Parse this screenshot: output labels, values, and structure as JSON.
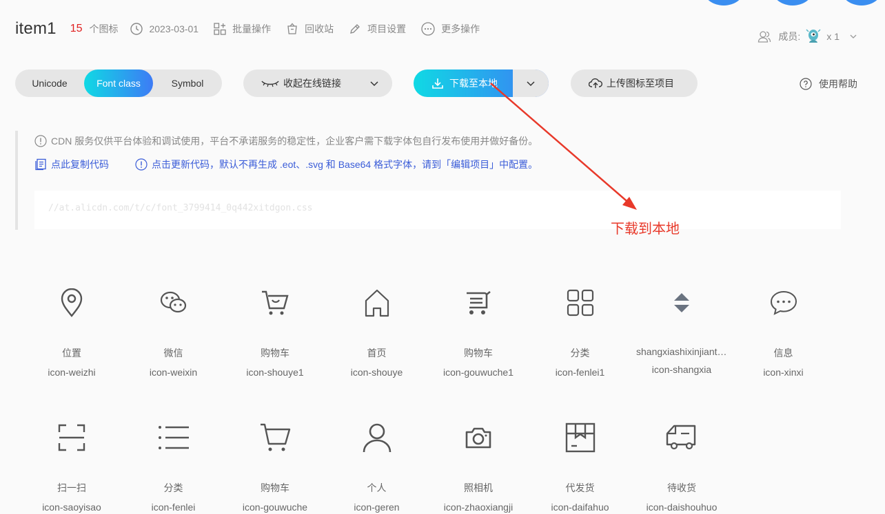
{
  "header": {
    "title": "item1",
    "icon_count": "15",
    "icon_count_label": "个图标",
    "date": "2023-03-01",
    "batch": "批量操作",
    "recycle": "回收站",
    "settings": "项目设置",
    "more": "更多操作",
    "members_label": "成员:",
    "members_count": "x 1"
  },
  "toolbar": {
    "tabs": [
      "Unicode",
      "Font class",
      "Symbol"
    ],
    "active_tab": "Font class",
    "collapse_link": "收起在线链接",
    "download": "下载至本地",
    "upload": "上传图标至项目",
    "help": "使用帮助"
  },
  "notice": {
    "cdn_warning": "CDN 服务仅供平台体验和调试使用，平台不承诺服务的稳定性，企业客户需下载字体包自行发布使用并做好备份。",
    "copy_code": "点此复制代码",
    "update_code": "点击更新代码，默认不再生成 .eot、.svg 和 Base64 格式字体，请到「编辑项目」中配置。",
    "css_url": "//at.alicdn.com/t/c/font_3799414_0q442xitdgon.css"
  },
  "annotation": "下载到本地",
  "colors": {
    "accent_start": "#10d9e4",
    "accent_end": "#3d7bf5",
    "count_red": "#e02020",
    "link_blue": "#3a5cd8",
    "annotation_red": "#e8392a"
  },
  "icons": [
    {
      "name": "位置",
      "code": "icon-weizhi",
      "glyph": "location-icon"
    },
    {
      "name": "微信",
      "code": "icon-weixin",
      "glyph": "wechat-icon"
    },
    {
      "name": "购物车",
      "code": "icon-shouye1",
      "glyph": "cart-smile-icon"
    },
    {
      "name": "首页",
      "code": "icon-shouye",
      "glyph": "home-icon"
    },
    {
      "name": "购物车",
      "code": "icon-gouwuche1",
      "glyph": "cart-list-icon"
    },
    {
      "name": "分类",
      "code": "icon-fenlei1",
      "glyph": "grid-icon"
    },
    {
      "name": "shangxiashixinjiantou",
      "code": "icon-shangxia",
      "glyph": "updown-icon"
    },
    {
      "name": "信息",
      "code": "icon-xinxi",
      "glyph": "message-icon"
    },
    {
      "name": "扫一扫",
      "code": "icon-saoyisao",
      "glyph": "scan-icon"
    },
    {
      "name": "分类",
      "code": "icon-fenlei",
      "glyph": "list-icon"
    },
    {
      "name": "购物车",
      "code": "icon-gouwuche",
      "glyph": "cart-icon"
    },
    {
      "name": "个人",
      "code": "icon-geren",
      "glyph": "user-icon"
    },
    {
      "name": "照相机",
      "code": "icon-zhaoxiangji",
      "glyph": "camera-icon"
    },
    {
      "name": "代发货",
      "code": "icon-daifahuo",
      "glyph": "box-icon"
    },
    {
      "name": "待收货",
      "code": "icon-daishouhuo",
      "glyph": "truck-icon"
    }
  ]
}
